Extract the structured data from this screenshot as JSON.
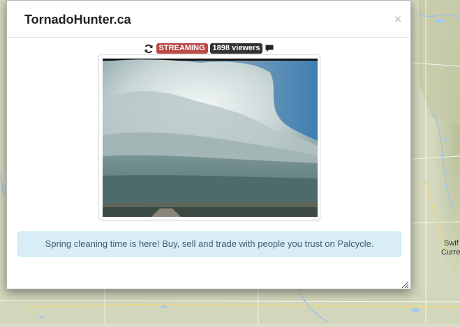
{
  "modal": {
    "title": "TornadoHunter.ca",
    "close_label": "×"
  },
  "stream": {
    "status_label": "STREAMING",
    "viewers_label": "1898 viewers",
    "status_color": "#b94a48",
    "viewers_color": "#333333"
  },
  "alert": {
    "message": "Spring cleaning time is here! Buy, sell and trade with people you trust on Palcycle."
  },
  "map": {
    "labels": [
      "Swif",
      "Curre"
    ]
  },
  "icons": [
    "refresh-icon",
    "chat-icon",
    "close-icon",
    "resize-handle-icon"
  ]
}
